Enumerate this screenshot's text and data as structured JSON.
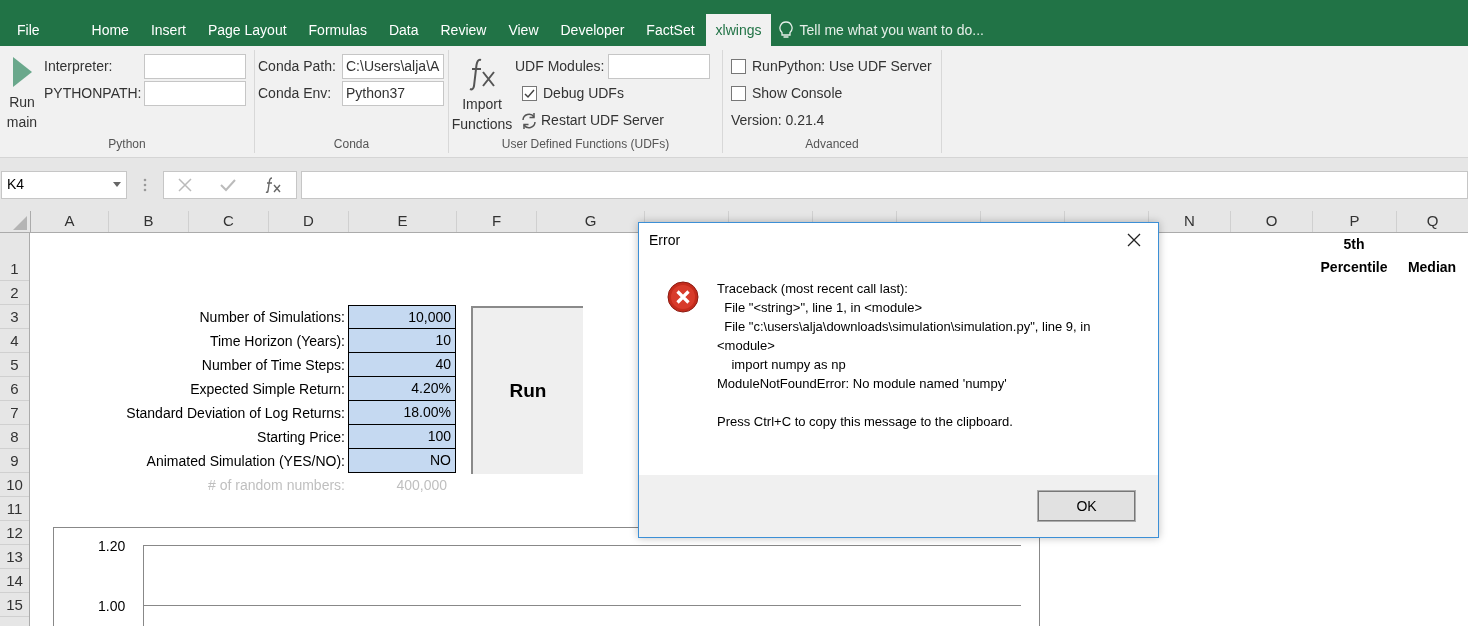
{
  "ribbon_tabs": [
    {
      "label": "File",
      "selected": false
    },
    {
      "label": "Home",
      "selected": false
    },
    {
      "label": "Insert",
      "selected": false
    },
    {
      "label": "Page Layout",
      "selected": false
    },
    {
      "label": "Formulas",
      "selected": false
    },
    {
      "label": "Data",
      "selected": false
    },
    {
      "label": "Review",
      "selected": false
    },
    {
      "label": "View",
      "selected": false
    },
    {
      "label": "Developer",
      "selected": false
    },
    {
      "label": "FactSet",
      "selected": false
    },
    {
      "label": "xlwings",
      "selected": true
    }
  ],
  "tell_me": "Tell me what you want to do...",
  "ribbon": {
    "python": {
      "run_button": "Run main",
      "fields": [
        {
          "label": "Interpreter:"
        },
        {
          "label": "PYTHONPATH:"
        }
      ],
      "group_label": "Python"
    },
    "conda": {
      "fields": [
        {
          "label": "Conda Path:",
          "value": "C:\\Users\\alja\\A"
        },
        {
          "label": "Conda Env:",
          "value": "Python37"
        }
      ],
      "group_label": "Conda"
    },
    "udfs": {
      "import_button": "Import Functions",
      "udf_modules_label": "UDF Modules:",
      "debug_udfs": {
        "label": "Debug UDFs",
        "checked": true
      },
      "restart_button": "Restart UDF Server",
      "group_label": "User Defined Functions (UDFs)"
    },
    "advanced": {
      "options": [
        {
          "label": "RunPython: Use UDF Server",
          "checked": false
        },
        {
          "label": "Show Console",
          "checked": false
        }
      ],
      "version": "Version: 0.21.4",
      "group_label": "Advanced"
    }
  },
  "name_box": "K4",
  "columns": [
    "A",
    "B",
    "C",
    "D",
    "E",
    "F",
    "G",
    "N",
    "O",
    "P",
    "Q"
  ],
  "rows": [
    "1",
    "2",
    "3",
    "4",
    "5",
    "6",
    "7",
    "8",
    "9",
    "10",
    "11",
    "12",
    "13",
    "14",
    "15"
  ],
  "header_cells": [
    {
      "text": "5th Percentile"
    },
    {
      "text": "Median"
    }
  ],
  "parameters": [
    {
      "label": "Number of Simulations:",
      "value": "10,000"
    },
    {
      "label": "Time Horizon (Years):",
      "value": "10"
    },
    {
      "label": "Number of Time Steps:",
      "value": "40"
    },
    {
      "label": "Expected Simple Return:",
      "value": "4.20%"
    },
    {
      "label": "Standard Deviation of Log Returns:",
      "value": "18.00%"
    },
    {
      "label": "Starting Price:",
      "value": "100"
    },
    {
      "label": "Animated Simulation (YES/NO):",
      "value": "NO"
    }
  ],
  "random_numbers": {
    "label": "# of random numbers:",
    "value": "400,000"
  },
  "run_shape": "Run",
  "chart": {
    "y_labels": [
      "1.20",
      "1.00"
    ]
  },
  "dialog": {
    "title": "Error",
    "message": "Traceback (most recent call last):\n  File \"<string>\", line 1, in <module>\n  File \"c:\\users\\alja\\downloads\\simulation\\simulation.py\", line 9, in <module>\n    import numpy as np\nModuleNotFoundError: No module named 'numpy'",
    "hint": "Press Ctrl+C to copy this message to the clipboard.",
    "ok_button": "OK"
  }
}
